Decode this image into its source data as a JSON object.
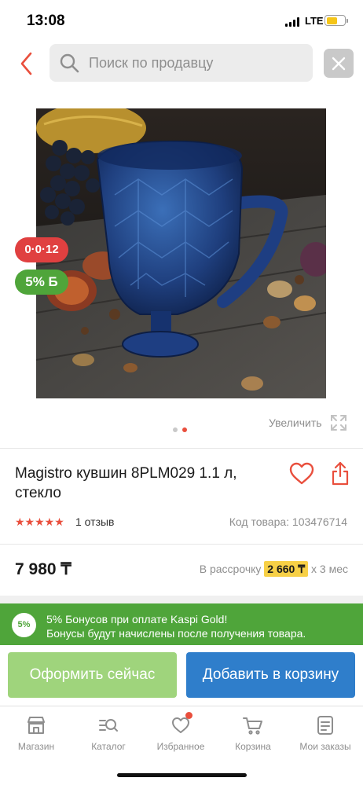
{
  "status_bar": {
    "time": "13:08",
    "network": "LTE",
    "battery_level": 0.6
  },
  "header": {
    "search_placeholder": "Поиск по продавцу"
  },
  "gallery": {
    "badge_installment": "0·0·12",
    "badge_bonus": "5% Б",
    "zoom_label": "Увеличить",
    "total_images": 2,
    "active_index": 1
  },
  "product": {
    "title": "Magistro кувшин 8PLM029 1.1 л, стекло",
    "rating": 5,
    "stars": "★★★★★",
    "reviews": "1 отзыв",
    "code": "Код товара: 103476714",
    "price": "7 980 ₸",
    "installment_prefix": "В рассрочку",
    "installment_amount": "2 660 ₸",
    "installment_suffix": "х 3 мес"
  },
  "bonus_banner": {
    "badge": "5%",
    "line1": "5% Бонусов при оплате Kaspi Gold!",
    "line2": "Бонусы будут начислены после получения товара."
  },
  "actions": {
    "checkout": "Оформить сейчас",
    "add_to_cart": "Добавить в корзину"
  },
  "bottom_nav": [
    {
      "label": "Магазин",
      "icon": "shop-icon"
    },
    {
      "label": "Каталог",
      "icon": "catalog-icon"
    },
    {
      "label": "Избранное",
      "icon": "heart-icon"
    },
    {
      "label": "Корзина",
      "icon": "cart-icon"
    },
    {
      "label": "Мои заказы",
      "icon": "orders-icon"
    }
  ],
  "colors": {
    "accent_red": "#e94f3d",
    "bonus_green": "#4fa53a",
    "checkout_green": "#9fd47c",
    "cart_blue": "#2f7ecb",
    "installment_yellow": "#f7d046"
  }
}
